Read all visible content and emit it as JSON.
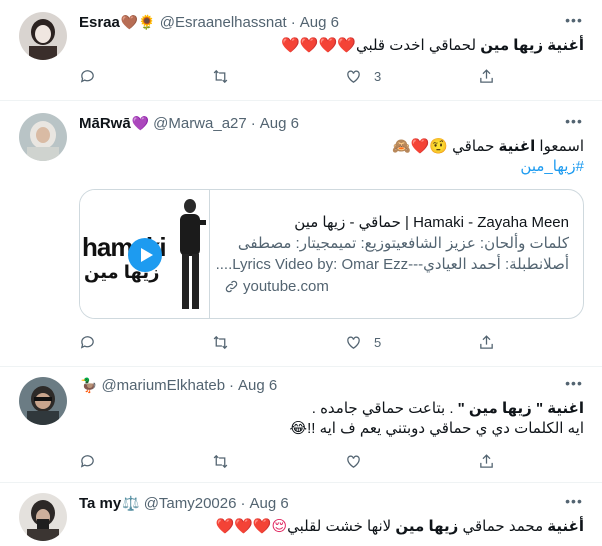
{
  "tweets": [
    {
      "name": "Esraa",
      "name_emoji": "🤎🌻",
      "handle": "@Esraanelhassnat",
      "date": "Aug 6",
      "text_bold": "أغنية زيها مين",
      "text_rest": " لحماقي اخدت قلبي",
      "text_emoji": "❤️❤️❤️❤️",
      "replies": "",
      "retweets": "",
      "likes": "3"
    },
    {
      "name": "MāRwā",
      "name_emoji": "💜",
      "handle": "@Marwa_a27",
      "date": "Aug 6",
      "line1_pre": "اسمعوا ",
      "line1_bold": "اغنية",
      "line1_post": " حماقي ",
      "line1_emoji": "🤨❤️🙈",
      "hashtag": "#زيها_مين",
      "card": {
        "title": "Hamaki - Zayaha Meen | حماقي - زيها مين",
        "desc1": "كلمات وألحان: عزيز الشافعيتوزيع: تميمجيتار: مصطفى",
        "desc2": "أصلانطبلة: أحمد العيادي---Lyrics Video by: Omar Ezz....",
        "url": "youtube.com",
        "thumb_brand": "hamaki",
        "thumb_brand2": "زيها مين"
      },
      "replies": "",
      "retweets": "",
      "likes": "5"
    },
    {
      "name": "",
      "name_emoji": "🦆",
      "handle": "@mariumElkhateb",
      "date": "Aug 6",
      "line1_bold": "اغنية \" زيها مين \"",
      "line1_rest": " . بتاعت حماقي جامده .",
      "line2": "ايه الكلمات دي ي حماقي دوبتني يعم ف ايه !!",
      "line2_emoji": "😂",
      "replies": "",
      "retweets": "",
      "likes": ""
    },
    {
      "name": "Ta my",
      "name_emoji": "⚖️",
      "handle": "@Tamy20026",
      "date": "Aug 6",
      "text_bold_a": "أغنية",
      "text_mid": " محمد حماقي ",
      "text_bold_b": "زيها مين",
      "text_rest": " لانها خشت لقلبي",
      "text_emoji": "😌❤️❤️❤️"
    }
  ],
  "more_label": "•••",
  "icons": [
    "reply-icon",
    "retweet-icon",
    "like-icon",
    "share-icon",
    "link-icon",
    "more-icon",
    "play-icon"
  ],
  "colors": {
    "accent": "#1d9bf0",
    "muted": "#536471",
    "heart": "#e0245e",
    "border": "#eff3f4"
  }
}
